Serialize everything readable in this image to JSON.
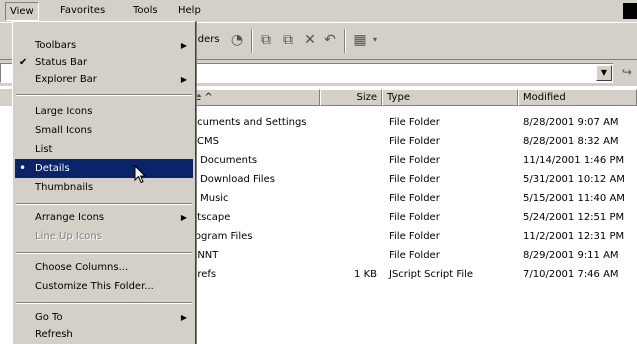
{
  "menubar": {
    "items": [
      "View",
      "Favorites",
      "Tools",
      "Help"
    ]
  },
  "toolbar": {
    "folders_partial": "lders",
    "icons": [
      "history-icon",
      "move-to-icon",
      "copy-to-icon",
      "delete-icon",
      "undo-icon",
      "views-icon"
    ]
  },
  "addressbar": {
    "dropdown_glyph": "▼"
  },
  "columns": {
    "name": "e ^",
    "size": "Size",
    "type": "Type",
    "modified": "Modified"
  },
  "files": [
    {
      "name": "ocuments and Settings",
      "size": "",
      "type": "File Folder",
      "modified": "8/28/2001 9:07 AM"
    },
    {
      "name": "PCMS",
      "size": "",
      "type": "File Folder",
      "modified": "8/28/2001 8:32 AM"
    },
    {
      "name": "y Documents",
      "size": "",
      "type": "File Folder",
      "modified": "11/14/2001 1:46 PM"
    },
    {
      "name": "y Download Files",
      "size": "",
      "type": "File Folder",
      "modified": "5/31/2001 10:12 AM"
    },
    {
      "name": "y Music",
      "size": "",
      "type": "File Folder",
      "modified": "5/15/2001 11:40 AM"
    },
    {
      "name": "etscape",
      "size": "",
      "type": "File Folder",
      "modified": "5/24/2001 12:51 PM"
    },
    {
      "name": "rogram Files",
      "size": "",
      "type": "File Folder",
      "modified": "11/2/2001 12:31 PM"
    },
    {
      "name": "/INNT",
      "size": "",
      "type": "File Folder",
      "modified": "8/29/2001 9:11 AM"
    },
    {
      "name": "prefs",
      "size": "1 KB",
      "type": "JScript Script File",
      "modified": "7/10/2001 7:46 AM"
    }
  ],
  "view_menu": {
    "toolbars": "Toolbars",
    "status_bar": "Status Bar",
    "explorer_bar": "Explorer Bar",
    "large_icons": "Large Icons",
    "small_icons": "Small Icons",
    "list": "List",
    "details": "Details",
    "thumbnails": "Thumbnails",
    "arrange_icons": "Arrange Icons",
    "line_up_icons": "Line Up Icons",
    "choose_columns": "Choose Columns...",
    "customize_folder": "Customize This Folder...",
    "go_to": "Go To",
    "refresh": "Refresh",
    "check_glyph": "✔",
    "radio_glyph": "•",
    "submenu_glyph": "▶"
  },
  "colors": {
    "face": "#d4d0c8",
    "highlight": "#0a246a"
  }
}
